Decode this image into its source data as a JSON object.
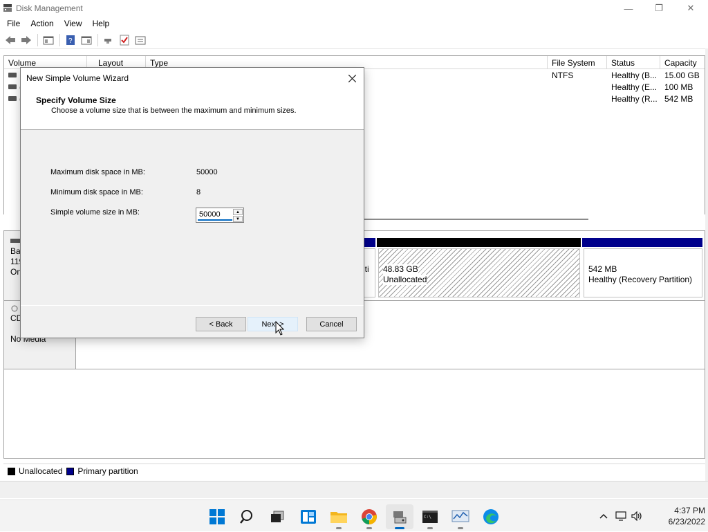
{
  "window": {
    "title": "Disk Management",
    "minimize": "—",
    "maximize": "❐",
    "close": "✕"
  },
  "menu": [
    "File",
    "Action",
    "View",
    "Help"
  ],
  "volume_list": {
    "columns": [
      "Volume",
      "Layout",
      "Type",
      "File System",
      "Status",
      "Capacity"
    ],
    "rows": [
      {
        "volume": "",
        "file_system": "NTFS",
        "status": "Healthy (B...",
        "capacity": "15.00 GB"
      },
      {
        "volume": "(",
        "file_system": "",
        "status": "Healthy (E...",
        "capacity": "100 MB"
      },
      {
        "volume": "(",
        "file_system": "",
        "status": "Healthy (R...",
        "capacity": "542 MB"
      }
    ]
  },
  "disks": [
    {
      "label_lines": [
        "Ba",
        "119",
        "On"
      ]
    },
    {
      "label_lines": [
        "CD",
        "",
        "No Media"
      ]
    }
  ],
  "partitions": [
    {
      "text": "iti"
    },
    {
      "size": "48.83 GB",
      "status": "Unallocated"
    },
    {
      "size": "542 MB",
      "status": "Healthy (Recovery Partition)"
    }
  ],
  "legend": [
    {
      "label": "Unallocated",
      "color": "#000000"
    },
    {
      "label": "Primary partition",
      "color": "#00008b"
    }
  ],
  "dialog": {
    "title": "New Simple Volume Wizard",
    "heading": "Specify Volume Size",
    "subheading": "Choose a volume size that is between the maximum and minimum sizes.",
    "max_label": "Maximum disk space in MB:",
    "max_value": "50000",
    "min_label": "Minimum disk space in MB:",
    "min_value": "8",
    "size_label": "Simple volume size in MB:",
    "size_value": "50000",
    "back": "< Back",
    "next": "Next >",
    "cancel": "Cancel"
  },
  "taskbar": {
    "apps": [
      "start-icon",
      "search-icon",
      "task-view-icon",
      "widgets-icon",
      "file-explorer-icon",
      "chrome-icon",
      "disk-management-icon",
      "terminal-icon",
      "performance-monitor-icon",
      "edge-icon"
    ],
    "time": "4:37 PM",
    "date": "6/23/2022"
  }
}
